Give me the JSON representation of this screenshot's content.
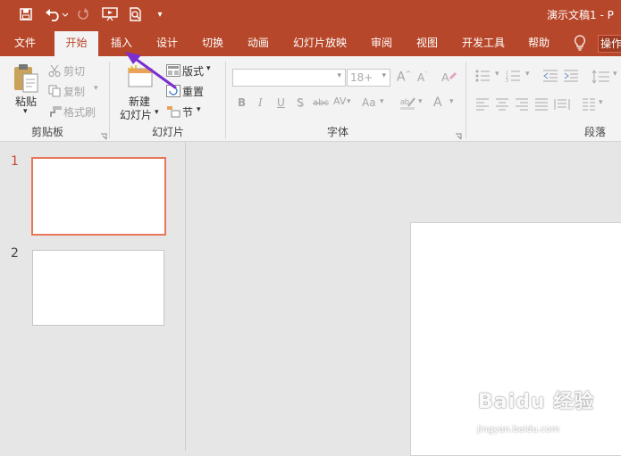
{
  "title_bar": {
    "document_title": "演示文稿1 - P",
    "customize_icon": "▾"
  },
  "tabs": [
    {
      "label": "文件"
    },
    {
      "label": "开始"
    },
    {
      "label": "插入"
    },
    {
      "label": "设计"
    },
    {
      "label": "切换"
    },
    {
      "label": "动画"
    },
    {
      "label": "幻灯片放映"
    },
    {
      "label": "审阅"
    },
    {
      "label": "视图"
    },
    {
      "label": "开发工具"
    },
    {
      "label": "帮助"
    },
    {
      "label": "操作"
    }
  ],
  "active_tab": "开始",
  "ribbon": {
    "clipboard": {
      "paste": "粘贴",
      "cut": "剪切",
      "copy": "复制",
      "format_painter": "格式刷",
      "group": "剪贴板"
    },
    "slides": {
      "new_slide_1": "新建",
      "new_slide_2": "幻灯片",
      "layout": "版式",
      "reset": "重置",
      "section": "节",
      "group": "幻灯片"
    },
    "font": {
      "font_name": "",
      "font_size": "18+",
      "bold": "B",
      "italic": "I",
      "underline": "U",
      "shadow": "S",
      "strike": "abc",
      "spacing": "AV",
      "case": "Aa",
      "color": "A",
      "group": "字体"
    },
    "paragraph": {
      "group": "段落"
    }
  },
  "slides": [
    {
      "number": "1",
      "selected": true
    },
    {
      "number": "2",
      "selected": false
    }
  ],
  "watermark": {
    "brand": "Baidu 经验",
    "url": "jingyan.baidu.com"
  },
  "colors": {
    "accent": "#b7472a",
    "arrow": "#7b2fd1",
    "selected_border": "#e8775a"
  }
}
